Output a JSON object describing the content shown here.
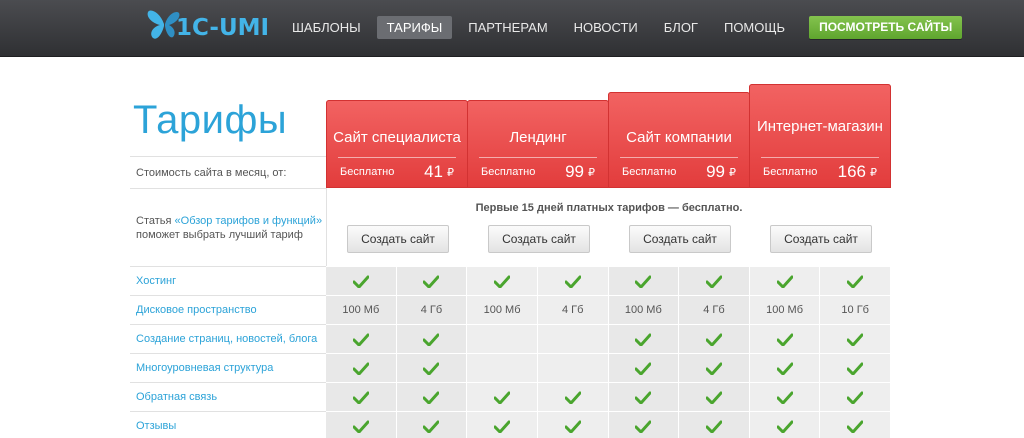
{
  "header": {
    "logo_text": "1C-UMI",
    "nav": [
      {
        "label": "ШАБЛОНЫ",
        "active": false
      },
      {
        "label": "ТАРИФЫ",
        "active": true
      },
      {
        "label": "ПАРТНЕРАМ",
        "active": false
      },
      {
        "label": "НОВОСТИ",
        "active": false
      },
      {
        "label": "БЛОГ",
        "active": false
      },
      {
        "label": "ПОМОЩЬ",
        "active": false
      }
    ],
    "cta_label": "ПОСМОТРЕТЬ САЙТЫ"
  },
  "page": {
    "title": "Тарифы",
    "price_label": "Стоимость сайта в месяц, от:",
    "article_prefix": "Статья ",
    "article_link": "«Обзор тарифов и функций»",
    "article_suffix": "поможет выбрать лучший тариф",
    "promo_text": "Первые 15 дней платных тарифов — бесплатно."
  },
  "plans": [
    {
      "name": "Сайт специалиста",
      "free_label": "Бесплатно",
      "price": "41",
      "currency": "₽",
      "button_label": "Создать сайт"
    },
    {
      "name": "Лендинг",
      "free_label": "Бесплатно",
      "price": "99",
      "currency": "₽",
      "button_label": "Создать сайт"
    },
    {
      "name": "Сайт компании",
      "free_label": "Бесплатно",
      "price": "99",
      "currency": "₽",
      "button_label": "Создать сайт"
    },
    {
      "name": "Интернет-магазин",
      "free_label": "Бесплатно",
      "price": "166",
      "currency": "₽",
      "button_label": "Создать сайт"
    }
  ],
  "features": [
    {
      "label": "Хостинг",
      "values": [
        "check",
        "check",
        "check",
        "check",
        "check",
        "check",
        "check",
        "check"
      ]
    },
    {
      "label": "Дисковое пространство",
      "values": [
        "100 Мб",
        "4 Гб",
        "100 Мб",
        "4 Гб",
        "100 Мб",
        "4 Гб",
        "100 Мб",
        "10 Гб"
      ]
    },
    {
      "label": "Создание страниц, новостей, блога",
      "values": [
        "check",
        "check",
        "",
        "",
        "check",
        "check",
        "check",
        "check"
      ]
    },
    {
      "label": "Многоуровневая структура",
      "values": [
        "check",
        "check",
        "",
        "",
        "check",
        "check",
        "check",
        "check"
      ]
    },
    {
      "label": "Обратная связь",
      "values": [
        "check",
        "check",
        "check",
        "check",
        "check",
        "check",
        "check",
        "check"
      ]
    },
    {
      "label": "Отзывы",
      "values": [
        "check",
        "check",
        "check",
        "check",
        "check",
        "check",
        "check",
        "check"
      ]
    }
  ],
  "colors": {
    "brand_blue": "#2ca3d8",
    "plan_red": "#e8484a",
    "check_green": "#4aa52e",
    "cta_green": "#6db33f"
  },
  "icons": {
    "logo": "butterfly-icon",
    "feature_available": "check-icon"
  }
}
